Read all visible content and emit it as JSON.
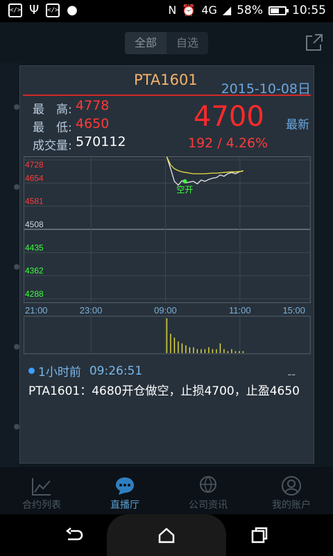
{
  "status_bar": {
    "notification_icons": [
      "code-icon",
      "usb-icon",
      "code-icon",
      "android-icon"
    ],
    "signal": "4G",
    "battery_percent": "58%",
    "battery_level": 0.58,
    "time": "10:55"
  },
  "header": {
    "segments": [
      "全部",
      "自选"
    ],
    "active_segment": 0
  },
  "card": {
    "symbol": "PTA1601",
    "date": "2015-10-08日",
    "high_label": "最　高:",
    "high_value": "4778",
    "low_label": "最　低:",
    "low_value": "4650",
    "volume_label": "成交量:",
    "volume_value": "570112",
    "last_price": "4700",
    "last_label": "最新",
    "change": "192 / 4.26%"
  },
  "chart_data": {
    "type": "line",
    "price_ticks": [
      "4728",
      "4654",
      "4581",
      "4508",
      "4435",
      "4362",
      "4288"
    ],
    "tick_colors": [
      "#ff3a3a",
      "#ff3a3a",
      "#ff3a3a",
      "#cfd8e0",
      "#3cff3c",
      "#3cff3c",
      "#3cff3c"
    ],
    "ylim": [
      4288,
      4728
    ],
    "time_ticks": [
      "21:00",
      "23:00",
      "09:00",
      "11:00",
      "15:00"
    ],
    "annotation": "空开",
    "series": [
      {
        "color": "#e8e8e8",
        "x": [
          0,
          1,
          2,
          3,
          4,
          5,
          6,
          7,
          8,
          9,
          10,
          11,
          12,
          13,
          14,
          15,
          16,
          17,
          18,
          19,
          20
        ],
        "values": [
          4738,
          4700,
          4660,
          4648,
          4662,
          4655,
          4658,
          4660,
          4652,
          4664,
          4660,
          4666,
          4670,
          4672,
          4680,
          4676,
          4684,
          4688,
          4684,
          4690,
          4694
        ]
      },
      {
        "color": "#e8e040",
        "x": [
          0,
          1,
          2,
          3,
          4,
          5,
          6,
          7,
          8,
          9,
          10,
          11,
          12,
          13,
          14,
          15,
          16,
          17,
          18,
          19,
          20
        ],
        "values": [
          4738,
          4712,
          4700,
          4694,
          4690,
          4688,
          4686,
          4684,
          4684,
          4684,
          4684,
          4685,
          4686,
          4686,
          4687,
          4688,
          4689,
          4690,
          4690,
          4691,
          4692
        ]
      }
    ],
    "volume": [
      18,
      10,
      8,
      6,
      5,
      4,
      3,
      3,
      2,
      2,
      2,
      3,
      2,
      2,
      5,
      2,
      1,
      2,
      1,
      1,
      1
    ]
  },
  "message": {
    "time_ago": "1小时前",
    "time": "09:26:51",
    "text": "PTA1601：4680开仓做空，止损4700，止盈4650",
    "side": "--"
  },
  "tabs": [
    {
      "label": "合约列表",
      "icon": "chart-icon"
    },
    {
      "label": "直播厅",
      "icon": "chat-icon"
    },
    {
      "label": "公司资讯",
      "icon": "globe-icon"
    },
    {
      "label": "我的账户",
      "icon": "user-icon"
    }
  ],
  "active_tab": 1
}
